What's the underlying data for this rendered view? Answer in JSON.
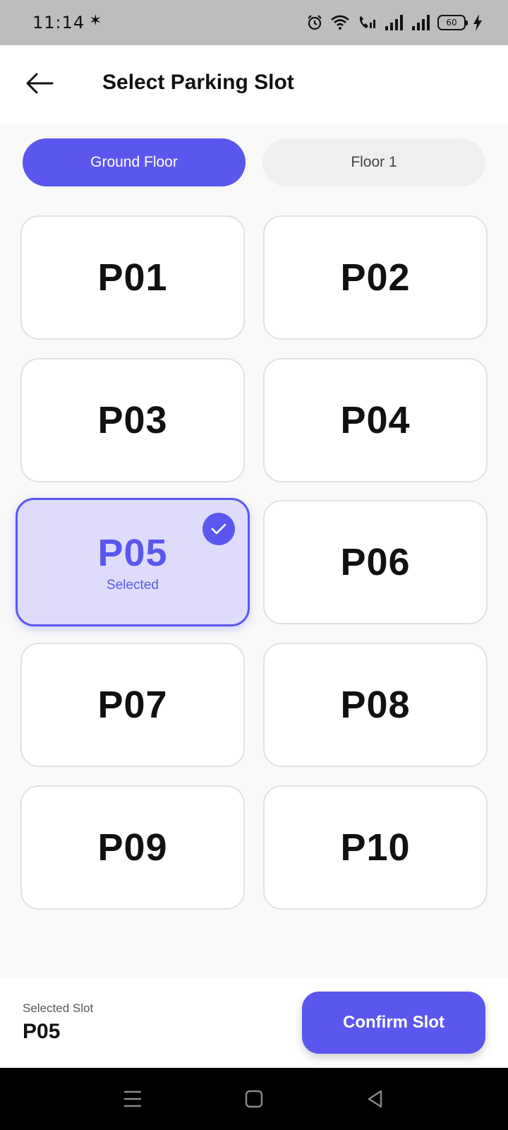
{
  "status_bar": {
    "time": "11:14",
    "battery": "60",
    "icons": [
      "sparkle-icon",
      "alarm-icon",
      "wifi-icon",
      "wifi-calling-icon",
      "signal-icon",
      "signal-icon",
      "battery-icon",
      "charging-icon"
    ]
  },
  "header": {
    "title": "Select Parking Slot",
    "back_icon": "arrow-left-icon"
  },
  "tabs": [
    {
      "label": "Ground Floor",
      "active": true
    },
    {
      "label": "Floor 1",
      "active": false
    }
  ],
  "slots": [
    {
      "label": "P01"
    },
    {
      "label": "P02"
    },
    {
      "label": "P03"
    },
    {
      "label": "P04"
    },
    {
      "label": "P05",
      "selected": true,
      "sub_label": "Selected"
    },
    {
      "label": "P06"
    },
    {
      "label": "P07"
    },
    {
      "label": "P08"
    },
    {
      "label": "P09"
    },
    {
      "label": "P10"
    }
  ],
  "bottom": {
    "caption": "Selected Slot",
    "value": "P05",
    "confirm_label": "Confirm Slot"
  },
  "colors": {
    "accent": "#5b57ee",
    "selected_bg": "#dedcfa",
    "status_bar": "#bdbdbd"
  }
}
